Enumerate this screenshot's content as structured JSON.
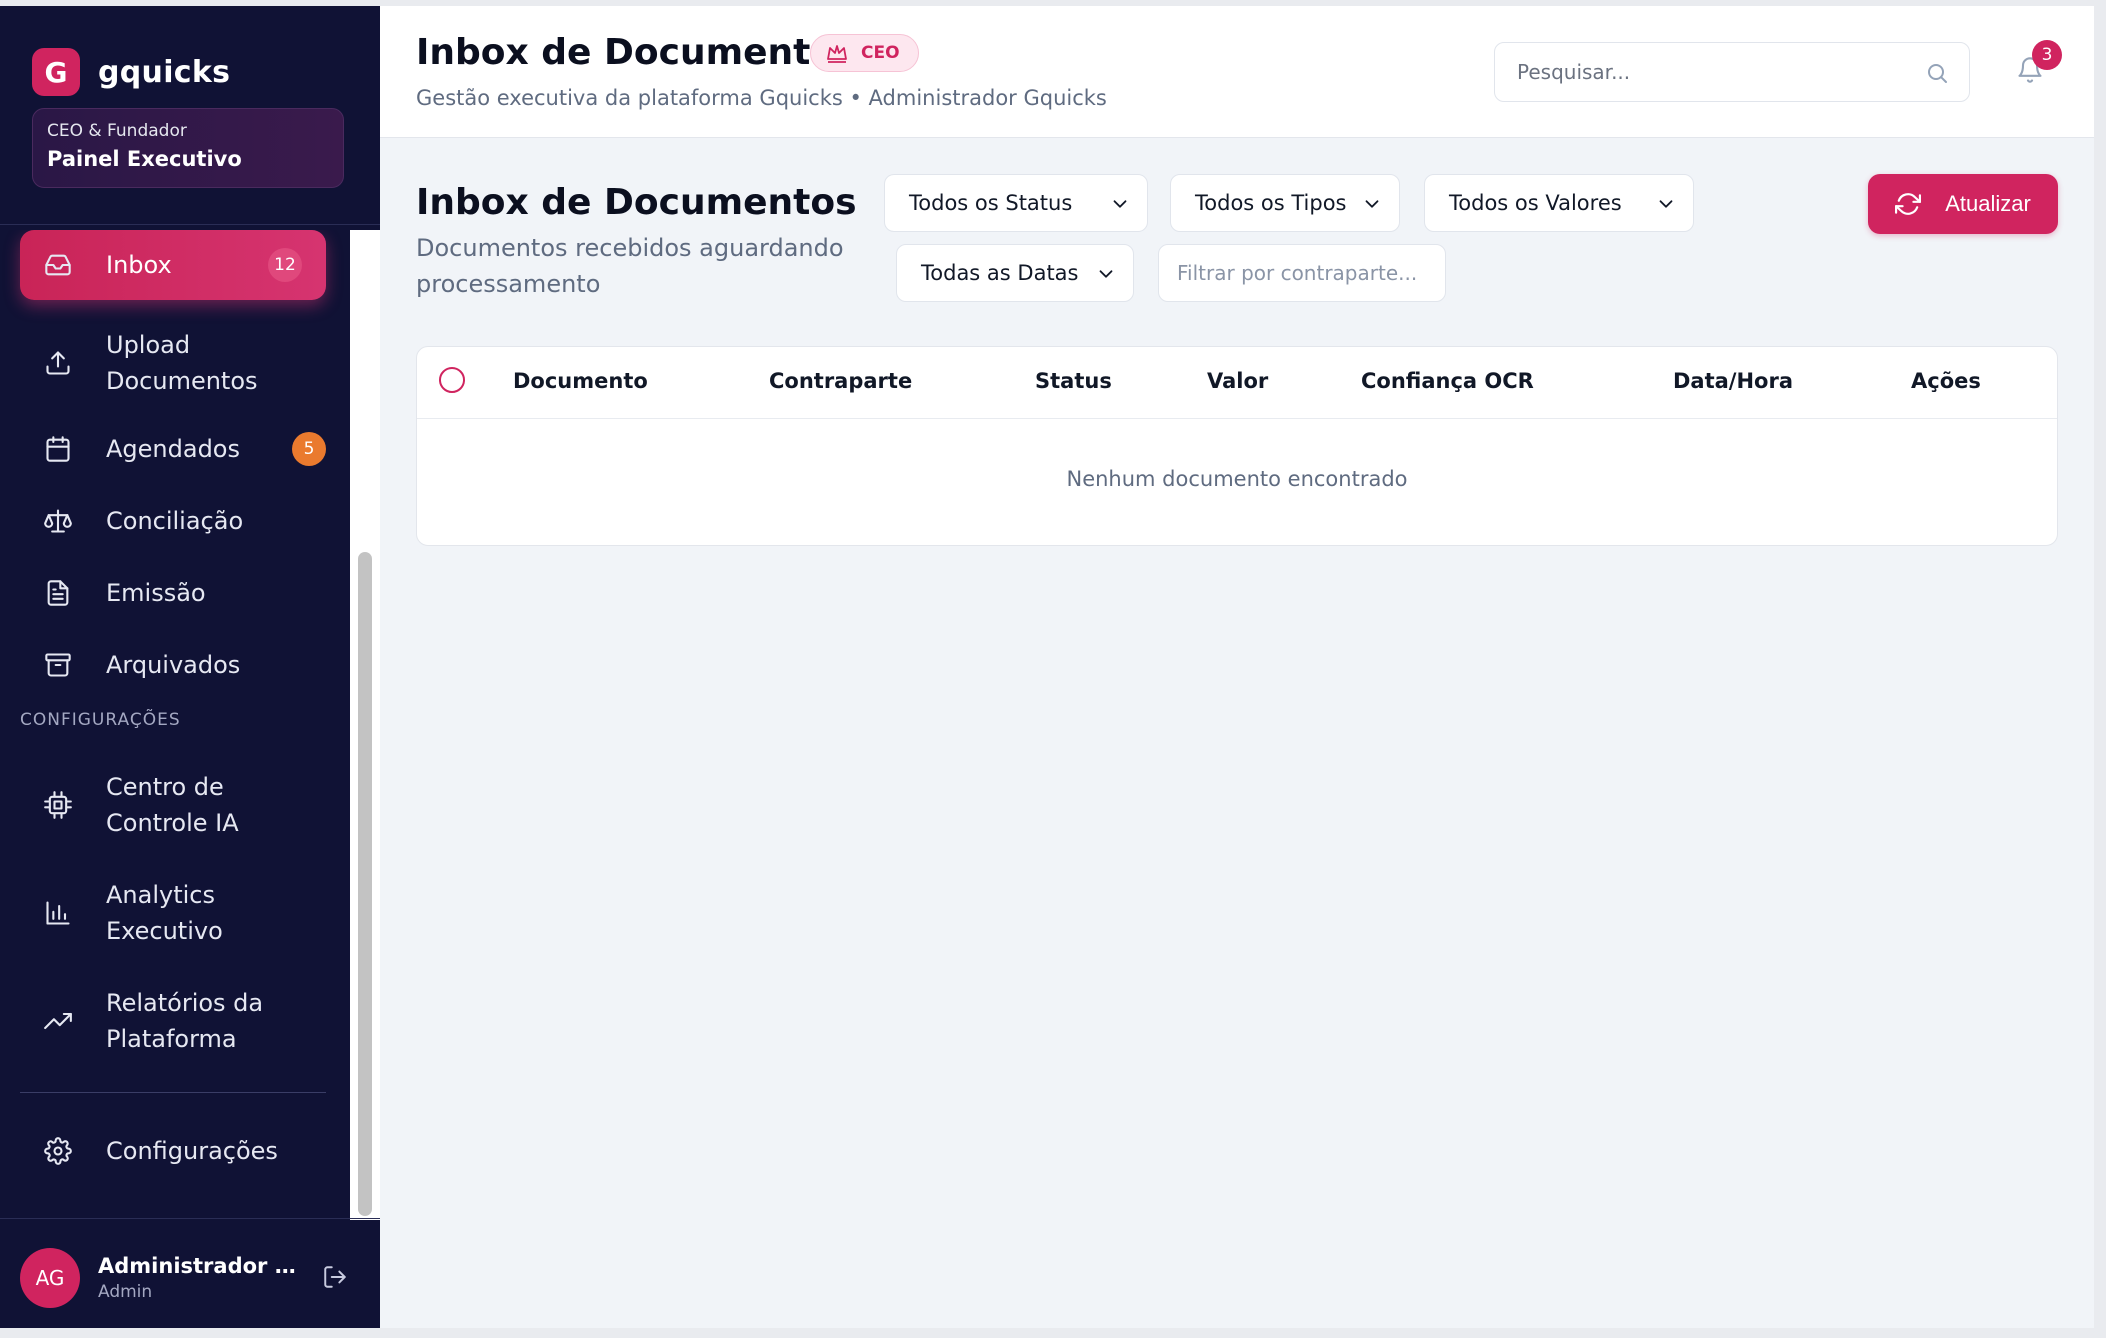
{
  "brand": {
    "logo_letter": "G",
    "name": "gquicks"
  },
  "role_card": {
    "subtitle": "CEO & Fundador",
    "title": "Painel Executivo"
  },
  "sidebar": {
    "items": [
      {
        "label": "Inbox",
        "icon": "inbox-icon",
        "badge": "12",
        "active": true
      },
      {
        "label": "Upload Documentos",
        "icon": "upload-icon"
      },
      {
        "label": "Agendados",
        "icon": "calendar-icon",
        "badge": "5"
      },
      {
        "label": "Conciliação",
        "icon": "scale-icon"
      },
      {
        "label": "Emissão",
        "icon": "file-text-icon"
      },
      {
        "label": "Arquivados",
        "icon": "archive-icon"
      }
    ],
    "section_label": "CONFIGURAÇÕES",
    "config_items": [
      {
        "label": "Centro de Controle IA",
        "icon": "cpu-icon"
      },
      {
        "label": "Analytics Executivo",
        "icon": "bar-chart-icon"
      },
      {
        "label": "Relatórios da Plataforma",
        "icon": "trending-up-icon"
      }
    ],
    "settings": {
      "label": "Configurações",
      "icon": "gear-icon"
    }
  },
  "user": {
    "initials": "AG",
    "name": "Administrador Gquicks",
    "role": "Admin"
  },
  "header": {
    "title": "Inbox de Documentos",
    "badge": "CEO",
    "subtitle": "Gestão executiva da plataforma Gquicks • Administrador Gquicks",
    "search_placeholder": "Pesquisar...",
    "notifications": "3"
  },
  "main": {
    "title": "Inbox de Documentos",
    "subtitle": "Documentos recebidos aguardando processamento",
    "filters": {
      "status": "Todos os Status",
      "tipos": "Todos os Tipos",
      "valores": "Todos os Valores",
      "datas": "Todas as Datas",
      "counterparty_placeholder": "Filtrar por contraparte..."
    },
    "refresh_label": "Atualizar",
    "table": {
      "columns": [
        "Documento",
        "Contraparte",
        "Status",
        "Valor",
        "Confiança OCR",
        "Data/Hora",
        "Ações"
      ],
      "empty_message": "Nenhum documento encontrado"
    }
  },
  "colors": {
    "sidebar_bg": "#101235",
    "accent": "#d0245f",
    "badge_orange": "#ea7a2e",
    "page_bg": "#f1f4f8"
  }
}
